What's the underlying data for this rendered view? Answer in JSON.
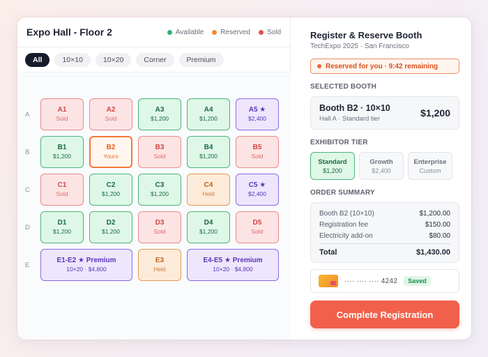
{
  "left": {
    "title": "Expo Hall - Floor 2",
    "legend": [
      {
        "label": "Available",
        "color": "#2fb574"
      },
      {
        "label": "Reserved",
        "color": "#f08a35"
      },
      {
        "label": "Sold",
        "color": "#e45050"
      }
    ],
    "filters": [
      "All",
      "10×10",
      "10×20",
      "Corner",
      "Premium"
    ],
    "rows": [
      "A",
      "B",
      "C",
      "D",
      "E"
    ]
  },
  "booths": {
    "A1": {
      "name": "A1",
      "status": "Sold"
    },
    "A2": {
      "name": "A2",
      "status": "Sold"
    },
    "A3": {
      "name": "A3",
      "status": "$1,200"
    },
    "A4": {
      "name": "A4",
      "status": "$1,200"
    },
    "A5": {
      "name": "A5 ★",
      "status": "$2,400"
    },
    "B1": {
      "name": "B1",
      "status": "$1,200"
    },
    "B2": {
      "name": "B2",
      "status": "Yours"
    },
    "B3": {
      "name": "B3",
      "status": "Sold"
    },
    "B4": {
      "name": "B4",
      "status": "$1,200"
    },
    "B5": {
      "name": "B5",
      "status": "Sold"
    },
    "C1": {
      "name": "C1",
      "status": "Sold"
    },
    "C2": {
      "name": "C2",
      "status": "$1,200"
    },
    "C3": {
      "name": "C3",
      "status": "$1,200"
    },
    "C4": {
      "name": "C4",
      "status": "Held"
    },
    "C5": {
      "name": "C5 ★",
      "status": "$2,400"
    },
    "D1": {
      "name": "D1",
      "status": "$1,200"
    },
    "D2": {
      "name": "D2",
      "status": "$1,200"
    },
    "D3": {
      "name": "D3",
      "status": "Sold"
    },
    "D4": {
      "name": "D4",
      "status": "$1,200"
    },
    "D5": {
      "name": "D5",
      "status": "Sold"
    },
    "E1E2": {
      "name": "E1-E2 ★ Premium",
      "status": "10×20 · $4,800"
    },
    "E3": {
      "name": "E3",
      "status": "Held"
    },
    "E4E5": {
      "name": "E4-E5 ★ Premium",
      "status": "10×20 · $4,800"
    }
  },
  "right": {
    "title": "Register & Reserve Booth",
    "subtitle": "TechExpo 2025 · San Francisco",
    "timer": "Reserved for you · 9:42 remaining",
    "selected_heading": "SELECTED BOOTH",
    "selected_name": "Booth B2 · 10×10",
    "selected_sub": "Hall A · Standard tier",
    "selected_price": "$1,200",
    "tier_heading": "EXHIBITOR TIER",
    "tiers": [
      {
        "name": "Standard",
        "price": "$1,200"
      },
      {
        "name": "Growth",
        "price": "$2,400"
      },
      {
        "name": "Enterprise",
        "price": "Custom"
      }
    ],
    "summary_heading": "ORDER SUMMARY",
    "summary": [
      {
        "label": "Booth B2 (10×10)",
        "value": "$1,200.00"
      },
      {
        "label": "Registration fee",
        "value": "$150.00"
      },
      {
        "label": "Electricity add-on",
        "value": "$80.00"
      }
    ],
    "total_label": "Total",
    "total_value": "$1,430.00",
    "card_number": "···· ···· ···· 4242",
    "card_badge": "Saved",
    "cta": "Complete Registration"
  }
}
